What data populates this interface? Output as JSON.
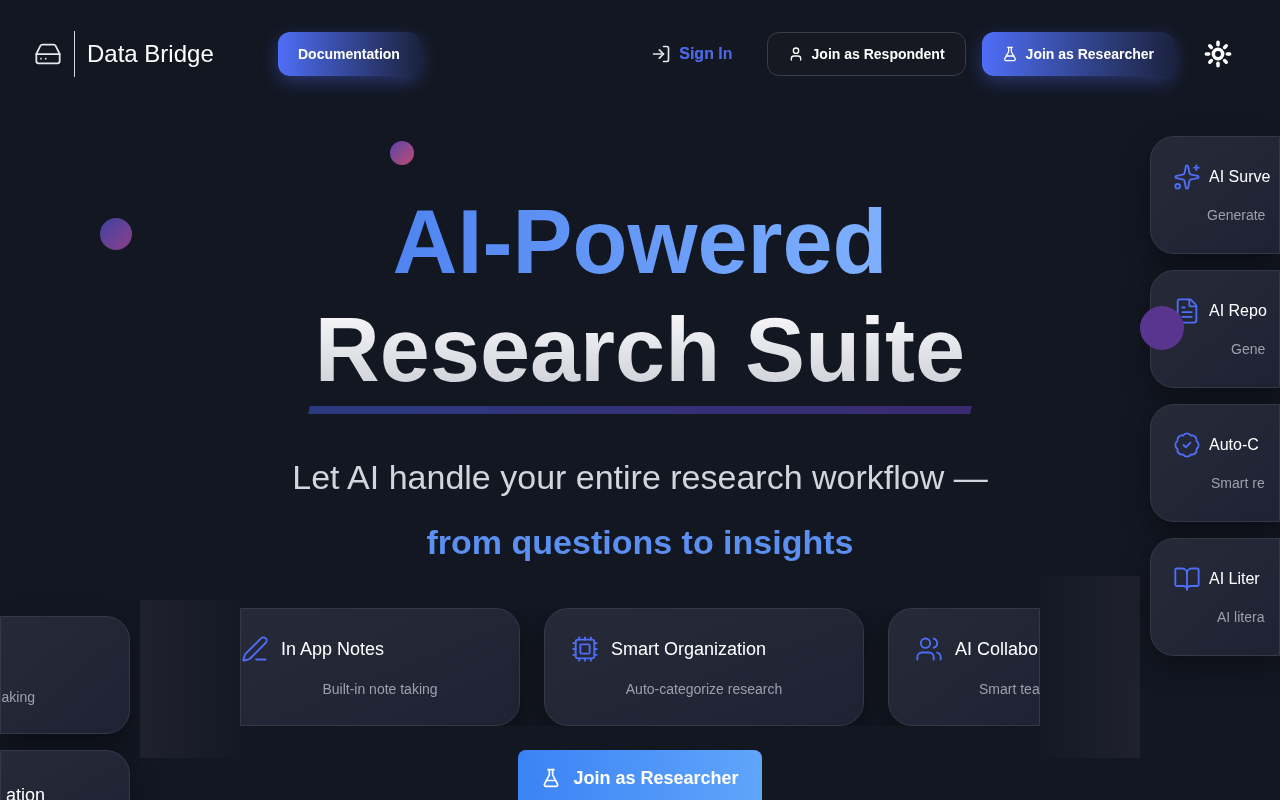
{
  "header": {
    "brand": "Data Bridge",
    "nav": [
      {
        "kind": "primary",
        "label": "Documentation"
      },
      {
        "kind": "link",
        "label": "Sign In"
      },
      {
        "kind": "outline",
        "label": "Join as Respondent"
      },
      {
        "kind": "primary",
        "label": "Join as Researcher"
      }
    ]
  },
  "hero": {
    "title_line_1": "AI-Powered",
    "title_line_2": "Research Suite",
    "subtitle": "Let AI handle your entire research workflow —",
    "highlight": "from questions to insights"
  },
  "side_features": [
    {
      "title": "AI Surve",
      "description": "Generate"
    },
    {
      "title": "AI Repo",
      "description": "Gene"
    },
    {
      "title": "Auto-C",
      "description": "Smart re"
    },
    {
      "title": "AI Liter",
      "description": "AI litera"
    }
  ],
  "left_features": [
    {
      "description": "aking"
    },
    {
      "title": "ation"
    }
  ],
  "bottom_features": [
    {
      "title": "In App Notes",
      "description": "Built-in note taking"
    },
    {
      "title": "Smart Organization",
      "description": "Auto-categorize research"
    },
    {
      "title": "AI Collabo",
      "description": "Smart tea"
    }
  ],
  "cta": {
    "label": "Join as Researcher"
  }
}
